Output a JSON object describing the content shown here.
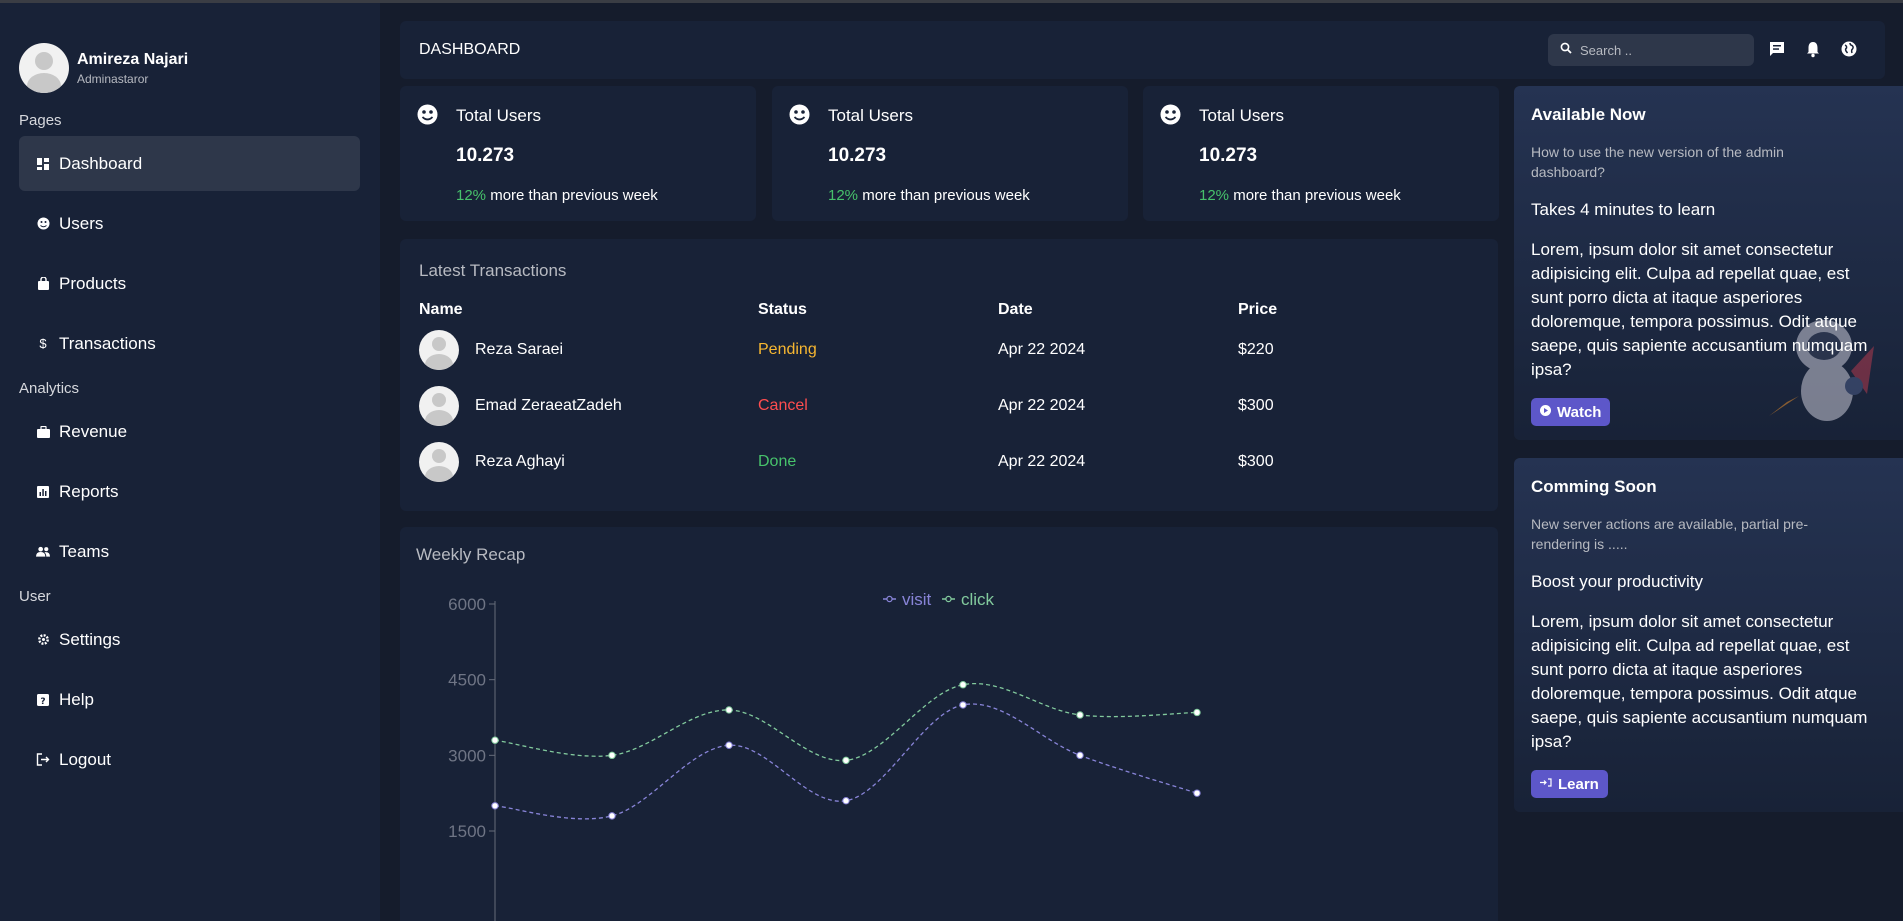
{
  "user": {
    "name": "Amireza Najari",
    "role": "Adminastaror"
  },
  "sidebar": {
    "sections": [
      {
        "label": "Pages",
        "items": [
          {
            "label": "Dashboard",
            "icon": "dashboard-icon",
            "active": true
          },
          {
            "label": "Users",
            "icon": "users-icon"
          },
          {
            "label": "Products",
            "icon": "bag-icon"
          },
          {
            "label": "Transactions",
            "icon": "dollar-icon"
          }
        ]
      },
      {
        "label": "Analytics",
        "items": [
          {
            "label": "Revenue",
            "icon": "briefcase-icon"
          },
          {
            "label": "Reports",
            "icon": "chart-icon"
          },
          {
            "label": "Teams",
            "icon": "team-icon"
          }
        ]
      },
      {
        "label": "User",
        "items": [
          {
            "label": "Settings",
            "icon": "gear-icon"
          },
          {
            "label": "Help",
            "icon": "help-icon"
          },
          {
            "label": "Logout",
            "icon": "logout-icon"
          }
        ]
      }
    ]
  },
  "header": {
    "title": "DASHBOARD",
    "search_placeholder": "Search .."
  },
  "cards": [
    {
      "title": "Total Users",
      "value": "10.273",
      "pct": "12%",
      "detail": "more than previous week"
    },
    {
      "title": "Total Users",
      "value": "10.273",
      "pct": "12%",
      "detail": "more than previous week"
    },
    {
      "title": "Total Users",
      "value": "10.273",
      "pct": "12%",
      "detail": "more than previous week"
    }
  ],
  "transactions": {
    "title": "Latest Transactions",
    "columns": [
      "Name",
      "Status",
      "Date",
      "Price"
    ],
    "rows": [
      {
        "name": "Reza Saraei",
        "status": "Pending",
        "date": "Apr 22 2024",
        "price": "$220"
      },
      {
        "name": "Emad ZeraeatZadeh",
        "status": "Cancel",
        "date": "Apr 22 2024",
        "price": "$300"
      },
      {
        "name": "Reza Aghayi",
        "status": "Done",
        "date": "Apr 22 2024",
        "price": "$300"
      }
    ]
  },
  "colors": {
    "accent": "#5d57c9",
    "pending": "#f7b731",
    "cancel": "#ff4d4f",
    "done": "#47c26b",
    "visit": "#8884d8",
    "click": "#82ca9d"
  },
  "chart_data": {
    "type": "line",
    "title": "Weekly Recap",
    "categories": [
      "",
      "",
      "",
      "",
      "",
      "",
      ""
    ],
    "series": [
      {
        "name": "visit",
        "values": [
          2000,
          1800,
          3200,
          2100,
          4000,
          3000,
          2250
        ]
      },
      {
        "name": "click",
        "values": [
          3300,
          3000,
          3900,
          2900,
          4400,
          3800,
          3850
        ]
      }
    ],
    "yticks": [
      1500,
      3000,
      4500,
      6000
    ],
    "ylim": [
      0,
      6000
    ],
    "legend": "top-center",
    "grid": false
  },
  "panels": [
    {
      "title": "Available Now",
      "subtitle": "How to use the new version of the admin dashboard?",
      "heading": "Takes 4 minutes to learn",
      "body": "Lorem, ipsum dolor sit amet consectetur adipisicing elit. Culpa ad repellat quae, est sunt porro dicta at itaque asperiores doloremque, tempora possimus. Odit atque saepe, quis sapiente accusantium numquam ipsa?",
      "button": "Watch"
    },
    {
      "title": "Comming Soon",
      "subtitle": "New server actions are available, partial pre-rendering is .....",
      "heading": "Boost your productivity",
      "body": "Lorem, ipsum dolor sit amet consectetur adipisicing elit. Culpa ad repellat quae, est sunt porro dicta at itaque asperiores doloremque, tempora possimus. Odit atque saepe, quis sapiente accusantium numquam ipsa?",
      "button": "Learn"
    }
  ]
}
